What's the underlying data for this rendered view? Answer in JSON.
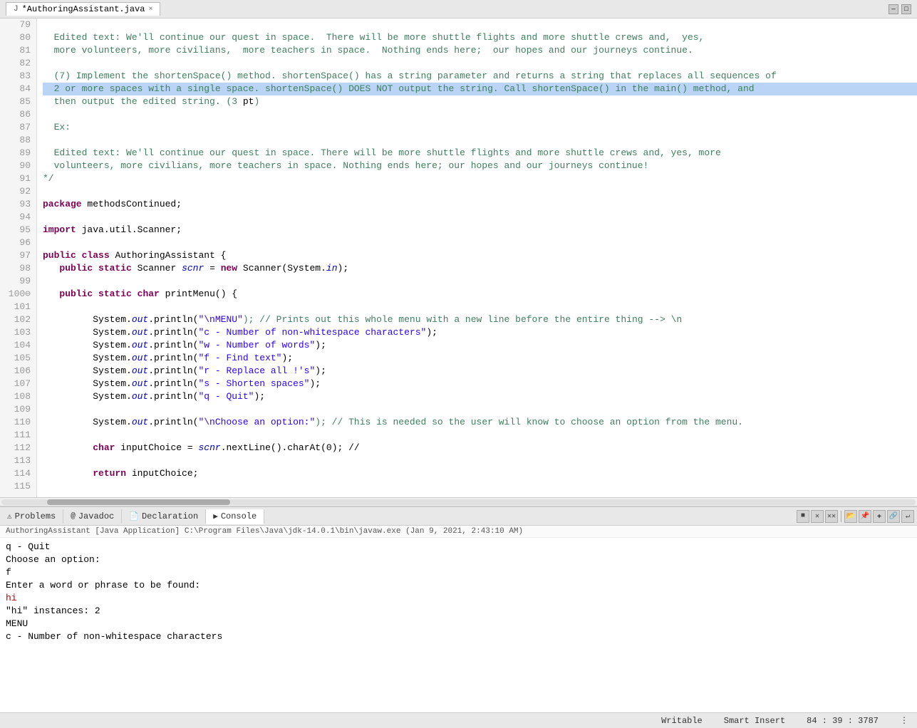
{
  "tab": {
    "label": "*AuthoringAssistant.java",
    "close": "×"
  },
  "windowControls": {
    "minimize": "—",
    "maximize": "□",
    "restore": "▭"
  },
  "codeLines": [
    {
      "num": 79,
      "highlighted": false,
      "tokens": [
        {
          "t": " ",
          "c": "plain"
        }
      ]
    },
    {
      "num": 80,
      "highlighted": false,
      "tokens": [
        {
          "t": "  Edited text: We'll continue our quest in space.  There will be more shuttle flights and more shuttle crews and,  yes,",
          "c": "comment"
        }
      ]
    },
    {
      "num": 81,
      "highlighted": false,
      "tokens": [
        {
          "t": "  more volunteers, more civilians,  more teachers in space.  Nothing ends here;  our hopes and our journeys continue.",
          "c": "comment"
        }
      ]
    },
    {
      "num": 82,
      "highlighted": false,
      "tokens": [
        {
          "t": " ",
          "c": "plain"
        }
      ]
    },
    {
      "num": 83,
      "highlighted": false,
      "tokens": [
        {
          "t": "  (7) Implement the shortenSpace() method. shortenSpace() has a string parameter and returns a string that replaces all sequences of",
          "c": "comment"
        }
      ]
    },
    {
      "num": 84,
      "highlighted": true,
      "tokens": [
        {
          "t": "  2 or more spaces with a single space. shortenSpace() DOES NOT output the string. Call shortenSpace() in the main() method, and",
          "c": "comment"
        }
      ]
    },
    {
      "num": 85,
      "highlighted": false,
      "tokens": [
        {
          "t": "  then output the edited string. (3 ",
          "c": "comment"
        },
        {
          "t": "pt",
          "c": "plain"
        },
        {
          "t": ")",
          "c": "comment"
        }
      ]
    },
    {
      "num": 86,
      "highlighted": false,
      "tokens": [
        {
          "t": " ",
          "c": "plain"
        }
      ]
    },
    {
      "num": 87,
      "highlighted": false,
      "tokens": [
        {
          "t": "  Ex:",
          "c": "comment"
        }
      ]
    },
    {
      "num": 88,
      "highlighted": false,
      "tokens": [
        {
          "t": " ",
          "c": "plain"
        }
      ]
    },
    {
      "num": 89,
      "highlighted": false,
      "tokens": [
        {
          "t": "  Edited text: We'll continue our quest in space. There will be more shuttle flights and more shuttle crews and, yes, more",
          "c": "comment"
        }
      ]
    },
    {
      "num": 90,
      "highlighted": false,
      "tokens": [
        {
          "t": "  volunteers, more civilians, more teachers in space. Nothing ends here; our hopes and our journeys continue!",
          "c": "comment"
        }
      ]
    },
    {
      "num": 91,
      "highlighted": false,
      "tokens": [
        {
          "t": "*/",
          "c": "comment"
        }
      ]
    },
    {
      "num": 92,
      "highlighted": false,
      "tokens": [
        {
          "t": " ",
          "c": "plain"
        }
      ]
    },
    {
      "num": 93,
      "highlighted": false,
      "tokens": [
        {
          "t": "package",
          "c": "kw"
        },
        {
          "t": " methodsContinued;",
          "c": "plain"
        }
      ]
    },
    {
      "num": 94,
      "highlighted": false,
      "tokens": [
        {
          "t": " ",
          "c": "plain"
        }
      ]
    },
    {
      "num": 95,
      "highlighted": false,
      "tokens": [
        {
          "t": "import",
          "c": "kw"
        },
        {
          "t": " java.util.Scanner;",
          "c": "plain"
        }
      ]
    },
    {
      "num": 96,
      "highlighted": false,
      "tokens": [
        {
          "t": " ",
          "c": "plain"
        }
      ]
    },
    {
      "num": 97,
      "highlighted": false,
      "tokens": [
        {
          "t": "public",
          "c": "kw"
        },
        {
          "t": " ",
          "c": "plain"
        },
        {
          "t": "class",
          "c": "kw"
        },
        {
          "t": " AuthoringAssistant {",
          "c": "plain"
        }
      ]
    },
    {
      "num": 98,
      "highlighted": false,
      "tokens": [
        {
          "t": "   ",
          "c": "plain"
        },
        {
          "t": "public",
          "c": "kw"
        },
        {
          "t": " ",
          "c": "plain"
        },
        {
          "t": "static",
          "c": "kw"
        },
        {
          "t": " Scanner ",
          "c": "plain"
        },
        {
          "t": "scnr",
          "c": "field"
        },
        {
          "t": " = ",
          "c": "plain"
        },
        {
          "t": "new",
          "c": "kw"
        },
        {
          "t": " Scanner(System.",
          "c": "plain"
        },
        {
          "t": "in",
          "c": "field"
        },
        {
          "t": ");",
          "c": "plain"
        }
      ]
    },
    {
      "num": 99,
      "highlighted": false,
      "tokens": [
        {
          "t": " ",
          "c": "plain"
        }
      ]
    },
    {
      "num": "100⊖",
      "highlighted": false,
      "tokens": [
        {
          "t": "   ",
          "c": "plain"
        },
        {
          "t": "public",
          "c": "kw"
        },
        {
          "t": " ",
          "c": "plain"
        },
        {
          "t": "static",
          "c": "kw"
        },
        {
          "t": " ",
          "c": "plain"
        },
        {
          "t": "char",
          "c": "kw"
        },
        {
          "t": " printMenu() {",
          "c": "plain"
        }
      ]
    },
    {
      "num": 101,
      "highlighted": false,
      "tokens": [
        {
          "t": " ",
          "c": "plain"
        }
      ]
    },
    {
      "num": 102,
      "highlighted": false,
      "tokens": [
        {
          "t": "         System.",
          "c": "plain"
        },
        {
          "t": "out",
          "c": "field"
        },
        {
          "t": ".println(",
          "c": "plain"
        },
        {
          "t": "\"\\nMENU\"",
          "c": "string"
        },
        {
          "t": "); // Prints out this whole menu with a new line before the entire thing --> \\n",
          "c": "comment"
        }
      ]
    },
    {
      "num": 103,
      "highlighted": false,
      "tokens": [
        {
          "t": "         System.",
          "c": "plain"
        },
        {
          "t": "out",
          "c": "field"
        },
        {
          "t": ".println(",
          "c": "plain"
        },
        {
          "t": "\"c - Number of non-whitespace characters\"",
          "c": "string"
        },
        {
          "t": ");",
          "c": "plain"
        }
      ]
    },
    {
      "num": 104,
      "highlighted": false,
      "tokens": [
        {
          "t": "         System.",
          "c": "plain"
        },
        {
          "t": "out",
          "c": "field"
        },
        {
          "t": ".println(",
          "c": "plain"
        },
        {
          "t": "\"w - Number of words\"",
          "c": "string"
        },
        {
          "t": ");",
          "c": "plain"
        }
      ]
    },
    {
      "num": 105,
      "highlighted": false,
      "tokens": [
        {
          "t": "         System.",
          "c": "plain"
        },
        {
          "t": "out",
          "c": "field"
        },
        {
          "t": ".println(",
          "c": "plain"
        },
        {
          "t": "\"f - Find text\"",
          "c": "string"
        },
        {
          "t": ");",
          "c": "plain"
        }
      ]
    },
    {
      "num": 106,
      "highlighted": false,
      "tokens": [
        {
          "t": "         System.",
          "c": "plain"
        },
        {
          "t": "out",
          "c": "field"
        },
        {
          "t": ".println(",
          "c": "plain"
        },
        {
          "t": "\"r - Replace all !'s\"",
          "c": "string"
        },
        {
          "t": ");",
          "c": "plain"
        }
      ]
    },
    {
      "num": 107,
      "highlighted": false,
      "tokens": [
        {
          "t": "         System.",
          "c": "plain"
        },
        {
          "t": "out",
          "c": "field"
        },
        {
          "t": ".println(",
          "c": "plain"
        },
        {
          "t": "\"s - Shorten spaces\"",
          "c": "string"
        },
        {
          "t": ");",
          "c": "plain"
        }
      ]
    },
    {
      "num": 108,
      "highlighted": false,
      "tokens": [
        {
          "t": "         System.",
          "c": "plain"
        },
        {
          "t": "out",
          "c": "field"
        },
        {
          "t": ".println(",
          "c": "plain"
        },
        {
          "t": "\"q - Quit\"",
          "c": "string"
        },
        {
          "t": ");",
          "c": "plain"
        }
      ]
    },
    {
      "num": 109,
      "highlighted": false,
      "tokens": [
        {
          "t": " ",
          "c": "plain"
        }
      ]
    },
    {
      "num": 110,
      "highlighted": false,
      "tokens": [
        {
          "t": "         System.",
          "c": "plain"
        },
        {
          "t": "out",
          "c": "field"
        },
        {
          "t": ".println(",
          "c": "plain"
        },
        {
          "t": "\"\\nChoose an option:\"",
          "c": "string"
        },
        {
          "t": "); // This is needed so the user will know to choose an option from the menu.",
          "c": "comment"
        }
      ]
    },
    {
      "num": 111,
      "highlighted": false,
      "tokens": [
        {
          "t": " ",
          "c": "plain"
        }
      ]
    },
    {
      "num": 112,
      "highlighted": false,
      "tokens": [
        {
          "t": "         ",
          "c": "plain"
        },
        {
          "t": "char",
          "c": "kw"
        },
        {
          "t": " inputChoice = ",
          "c": "plain"
        },
        {
          "t": "scnr",
          "c": "field"
        },
        {
          "t": ".nextLine().charAt(0); //",
          "c": "plain"
        }
      ]
    },
    {
      "num": 113,
      "highlighted": false,
      "tokens": [
        {
          "t": " ",
          "c": "plain"
        }
      ]
    },
    {
      "num": 114,
      "highlighted": false,
      "tokens": [
        {
          "t": "         ",
          "c": "plain"
        },
        {
          "t": "return",
          "c": "kw"
        },
        {
          "t": " inputChoice;",
          "c": "plain"
        }
      ]
    },
    {
      "num": 115,
      "highlighted": false,
      "tokens": [
        {
          "t": " ",
          "c": "plain"
        }
      ]
    }
  ],
  "bottomTabs": [
    {
      "id": "problems",
      "label": "Problems",
      "icon": "⚠",
      "active": false
    },
    {
      "id": "javadoc",
      "label": "Javadoc",
      "icon": "@",
      "active": false
    },
    {
      "id": "declaration",
      "label": "Declaration",
      "icon": "📄",
      "active": false
    },
    {
      "id": "console",
      "label": "Console",
      "icon": "▶",
      "active": true
    }
  ],
  "consoleHeader": "AuthoringAssistant [Java Application] C:\\Program Files\\Java\\jdk-14.0.1\\bin\\javaw.exe (Jan 9, 2021, 2:43:10 AM)",
  "consoleLines": [
    "q - Quit",
    "",
    "Choose an option:",
    "f",
    "Enter a word or phrase to be found:",
    "hi",
    "\"hi\" instances: 2",
    "",
    "MENU",
    "c - Number of non-whitespace characters"
  ],
  "consoleRedLine": "hi",
  "toolbarButtons": [
    {
      "id": "stop",
      "label": "■",
      "tooltip": "Terminate"
    },
    {
      "id": "close",
      "label": "✕",
      "tooltip": "Remove"
    },
    {
      "id": "remove-all",
      "label": "✕✕",
      "tooltip": "Remove All"
    },
    {
      "id": "sep1",
      "type": "sep"
    },
    {
      "id": "open",
      "label": "📂",
      "tooltip": "Open Console"
    },
    {
      "id": "pin",
      "label": "📌",
      "tooltip": "Pin"
    },
    {
      "id": "new",
      "label": "✚",
      "tooltip": "New"
    },
    {
      "id": "link",
      "label": "🔗",
      "tooltip": "Link"
    },
    {
      "id": "word-wrap",
      "label": "↵",
      "tooltip": "Word Wrap"
    }
  ],
  "statusBar": {
    "writable": "Writable",
    "insertMode": "Smart Insert",
    "position": "84 : 39 : 3787"
  },
  "colors": {
    "highlightBg": "#bad4f5",
    "commentColor": "#3f7f5f",
    "keywordColor": "#7f0055",
    "keyword2Color": "#0000c0",
    "stringColor": "#2a00ff",
    "fieldColor": "#0000c0"
  }
}
